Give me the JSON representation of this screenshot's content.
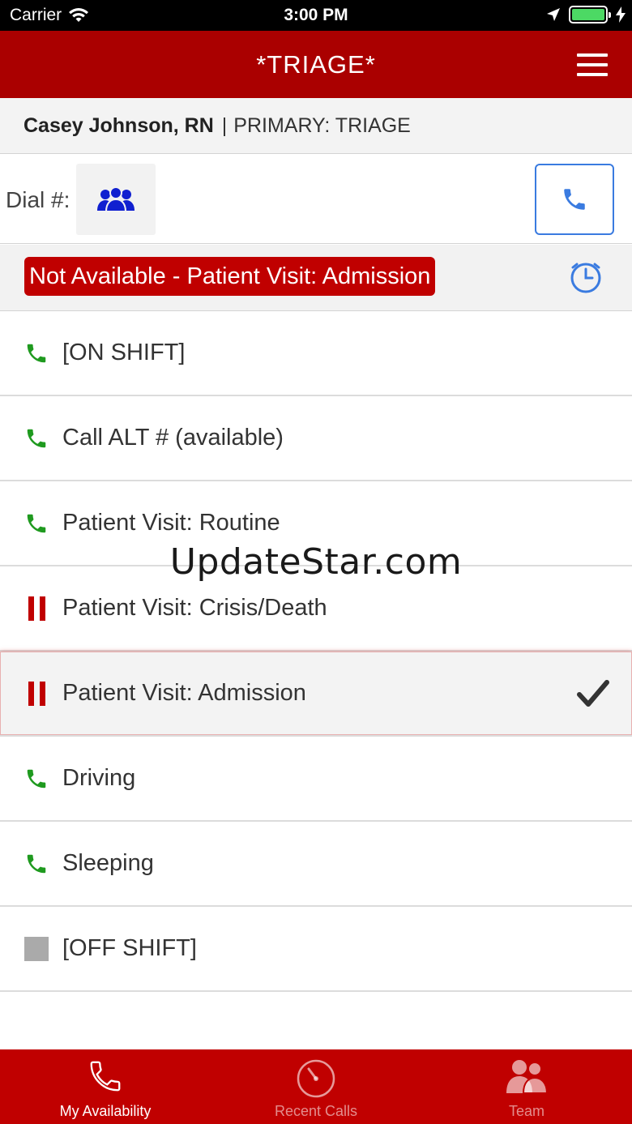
{
  "status_bar": {
    "carrier": "Carrier",
    "time": "3:00 PM"
  },
  "header": {
    "title": "*TRIAGE*",
    "menu_icon": "hamburger-menu-icon"
  },
  "user": {
    "name": "Casey Johnson, RN",
    "separator": "|",
    "role": "PRIMARY: TRIAGE"
  },
  "dial": {
    "label": "Dial #:",
    "contacts_icon": "group-icon",
    "call_icon": "phone-icon"
  },
  "current_status": {
    "text": "Not Available - Patient Visit: Admission",
    "history_icon": "clock-icon"
  },
  "options": [
    {
      "label": "[ON SHIFT]",
      "icon": "phone-icon",
      "selected": false
    },
    {
      "label": "Call ALT # (available)",
      "icon": "phone-icon",
      "selected": false
    },
    {
      "label": "Patient Visit: Routine",
      "icon": "phone-icon",
      "selected": false
    },
    {
      "label": "Patient Visit: Crisis/Death",
      "icon": "pause-icon",
      "selected": false
    },
    {
      "label": "Patient Visit: Admission",
      "icon": "pause-icon",
      "selected": true
    },
    {
      "label": "Driving",
      "icon": "phone-icon",
      "selected": false
    },
    {
      "label": "Sleeping",
      "icon": "phone-icon",
      "selected": false
    },
    {
      "label": "[OFF SHIFT]",
      "icon": "square-icon",
      "selected": false
    }
  ],
  "watermark": "UpdateStar.com",
  "tabs": [
    {
      "label": "My Availability",
      "icon": "phone-icon",
      "active": true
    },
    {
      "label": "Recent Calls",
      "icon": "dial-icon",
      "active": false
    },
    {
      "label": "Team",
      "icon": "team-icon",
      "active": false
    }
  ],
  "colors": {
    "brand_red": "#aa0000",
    "badge_red": "#c00000",
    "available_green": "#1f9a1f",
    "accent_blue": "#3a7be0"
  }
}
